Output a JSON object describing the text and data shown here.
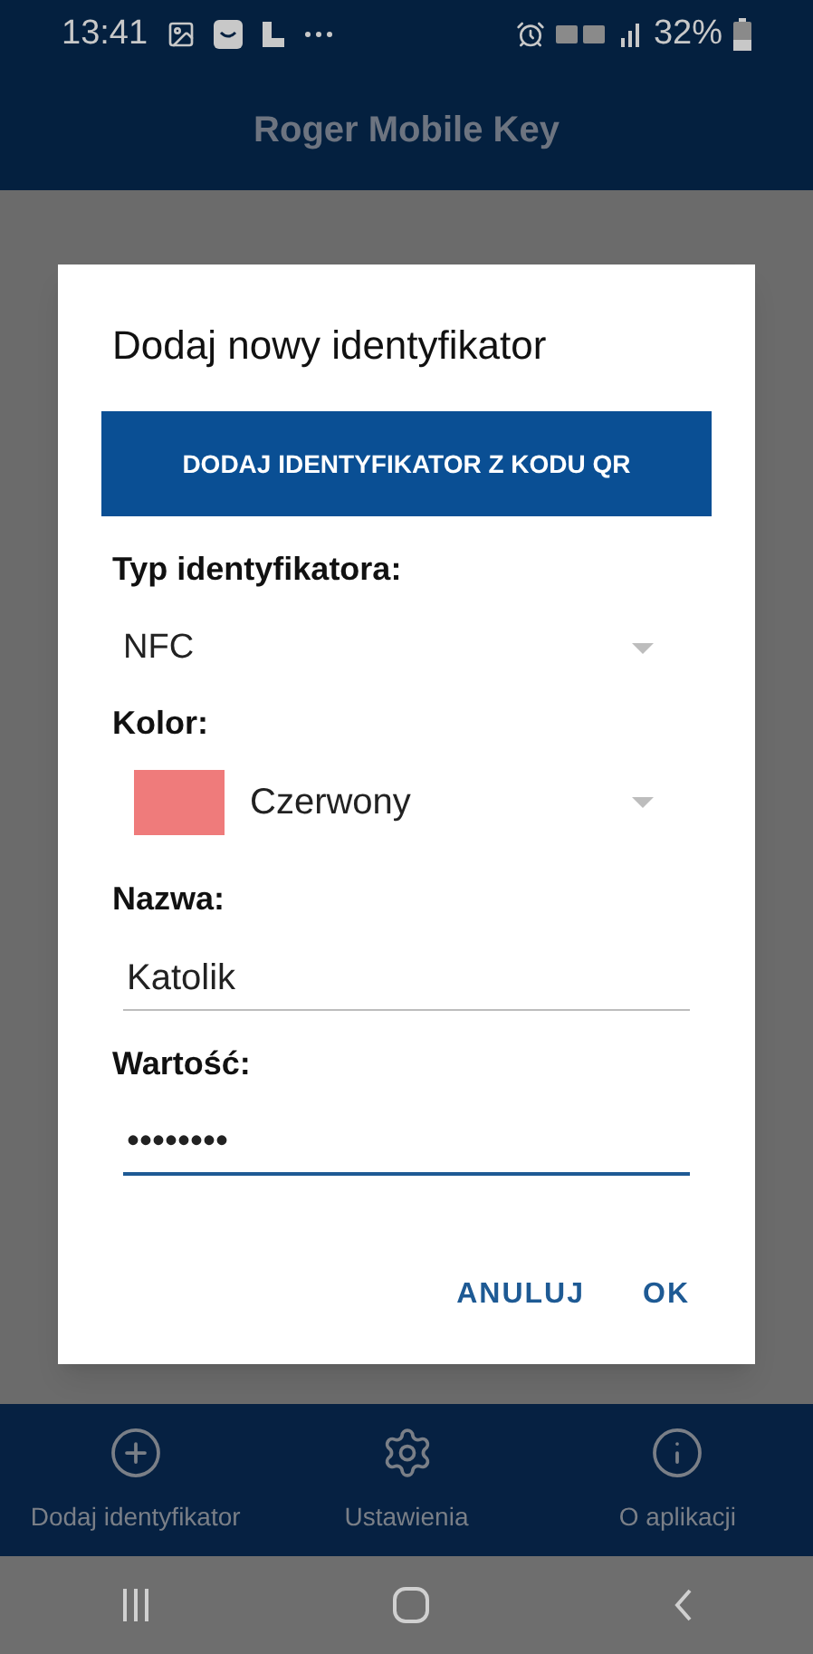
{
  "status_bar": {
    "time": "13:41",
    "battery": "32%"
  },
  "app_bar": {
    "title": "Roger Mobile Key"
  },
  "dialog": {
    "title": "Dodaj nowy identyfikator",
    "qr_button": "DODAJ IDENTYFIKATOR Z KODU QR",
    "type": {
      "label": "Typ identyfikatora:",
      "value": "NFC"
    },
    "color": {
      "label": "Kolor:",
      "value": "Czerwony",
      "color": "#ef7b7b"
    },
    "name": {
      "label": "Nazwa:",
      "value": "Katolik",
      "focused": false
    },
    "value": {
      "label": "Wartość:",
      "value": "••••••••",
      "focused": true
    },
    "buttons": [
      "ANULUJ",
      "OK"
    ]
  },
  "bottom_nav": [
    {
      "kind": "add",
      "label": "Dodaj identyfikator"
    },
    {
      "kind": "settings",
      "label": "Ustawienia"
    },
    {
      "kind": "info",
      "label": "O aplikacji"
    }
  ]
}
